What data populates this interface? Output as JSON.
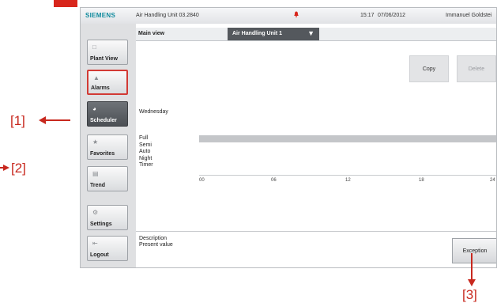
{
  "callouts": {
    "one": "[1]",
    "two": "[2]",
    "three": "[3]"
  },
  "statusbar": {
    "brand": "SIEMENS",
    "device": "Air Handling Unit 03.2840",
    "time": "15:17",
    "date": "07/06/2012",
    "user": "Immanuel Goldstei"
  },
  "sidebar": {
    "items": [
      {
        "label": "Plant View",
        "icon": "plant-view-icon"
      },
      {
        "label": "Alarms",
        "icon": "bell-icon"
      },
      {
        "label": "Scheduler",
        "icon": "scheduler-icon"
      },
      {
        "label": "Favorites",
        "icon": "star-icon"
      },
      {
        "label": "Trend",
        "icon": "trend-icon"
      },
      {
        "label": "Settings",
        "icon": "gear-icon"
      },
      {
        "label": "Logout",
        "icon": "logout-icon"
      }
    ]
  },
  "main": {
    "tab_label": "Main view",
    "unit_select": "Air Handling Unit 1",
    "copy_label": "Copy",
    "delete_label": "Delete",
    "day": "Wednesday",
    "modes": [
      "Full",
      "Semi",
      "Auto",
      "Night",
      "Timer"
    ],
    "axis_ticks": [
      "00",
      "06",
      "12",
      "18",
      "24"
    ],
    "description_label": "Description",
    "present_value_label": "Present value",
    "exception_label": "Exception"
  },
  "colors": {
    "brand": "#0f8a9d",
    "callout": "#c8281e",
    "active_nav": "#5a5e63",
    "alarm": "#d23a34"
  }
}
